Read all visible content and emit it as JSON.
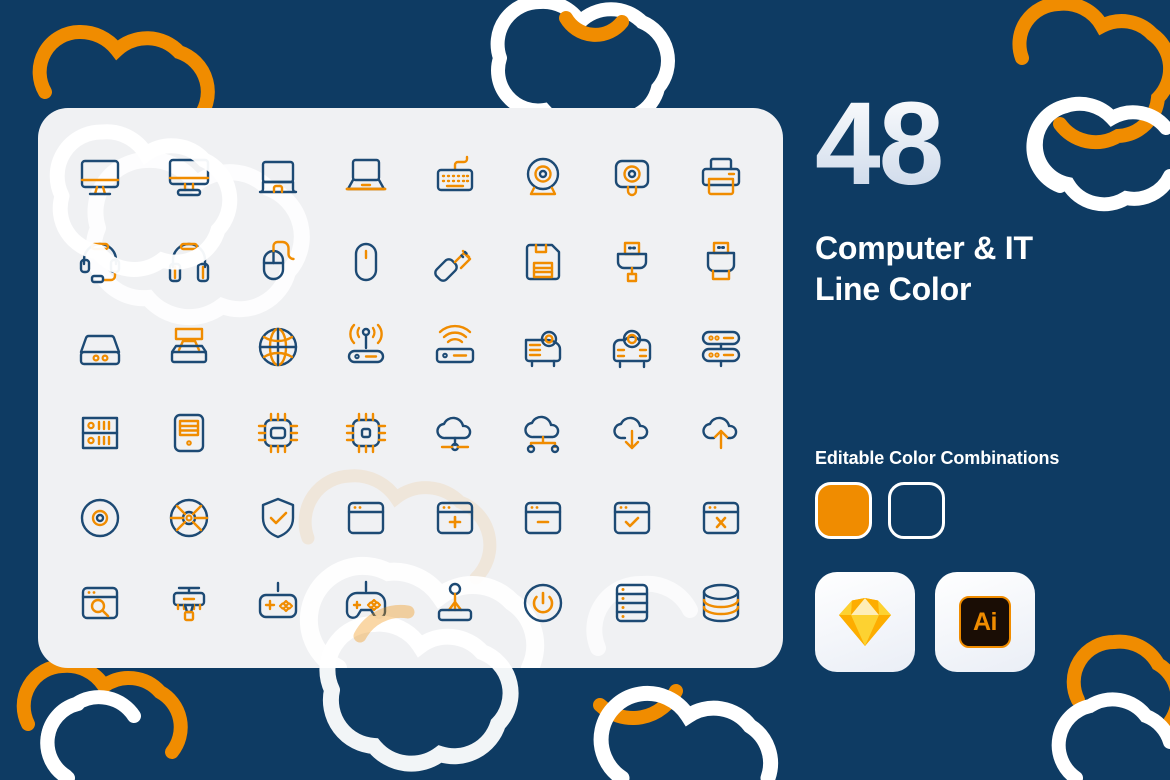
{
  "palette": {
    "background_navy": "#0E3B63",
    "card_gray": "#F0F1F3",
    "accent_orange": "#F08C00",
    "icon_navy": "#1D4A74",
    "white": "#FFFFFF"
  },
  "right_panel": {
    "count": "48",
    "title_line1": "Computer & IT",
    "title_line2": "Line Color",
    "combinations_label": "Editable Color Combinations",
    "swatches": [
      {
        "name": "orange-swatch",
        "style": "filled",
        "color": "#F08C00"
      },
      {
        "name": "outline-swatch",
        "style": "hollow",
        "color": "#FFFFFF"
      }
    ],
    "apps": [
      {
        "name": "sketch-badge",
        "label": ""
      },
      {
        "name": "illustrator-badge",
        "label": "Ai"
      }
    ]
  },
  "icon_grid": {
    "columns": 8,
    "rows": 6,
    "icons": [
      {
        "name": "desktop-monitor-icon"
      },
      {
        "name": "desktop-monitor-stand-icon"
      },
      {
        "name": "laptop-closed-icon"
      },
      {
        "name": "laptop-open-icon"
      },
      {
        "name": "keyboard-icon"
      },
      {
        "name": "webcam-round-icon"
      },
      {
        "name": "webcam-square-icon"
      },
      {
        "name": "printer-icon"
      },
      {
        "name": "headset-icon"
      },
      {
        "name": "headphones-icon"
      },
      {
        "name": "mouse-wired-icon"
      },
      {
        "name": "mouse-wireless-icon"
      },
      {
        "name": "usb-flash-drive-icon"
      },
      {
        "name": "floppy-disk-icon"
      },
      {
        "name": "usb-connector-icon"
      },
      {
        "name": "usb-plug-icon"
      },
      {
        "name": "external-hard-drive-icon"
      },
      {
        "name": "scanner-icon"
      },
      {
        "name": "globe-network-icon"
      },
      {
        "name": "wireless-router-icon"
      },
      {
        "name": "wifi-modem-icon"
      },
      {
        "name": "projector-icon"
      },
      {
        "name": "projector-front-icon"
      },
      {
        "name": "server-stack-icon"
      },
      {
        "name": "server-rack-icon"
      },
      {
        "name": "computer-tower-icon"
      },
      {
        "name": "cpu-chip-icon"
      },
      {
        "name": "processor-icon"
      },
      {
        "name": "cloud-network-icon"
      },
      {
        "name": "cloud-computing-icon"
      },
      {
        "name": "cloud-download-icon"
      },
      {
        "name": "cloud-upload-icon"
      },
      {
        "name": "compact-disc-icon"
      },
      {
        "name": "dvd-disc-icon"
      },
      {
        "name": "security-shield-icon"
      },
      {
        "name": "browser-window-icon"
      },
      {
        "name": "browser-add-icon"
      },
      {
        "name": "browser-remove-icon"
      },
      {
        "name": "browser-check-icon"
      },
      {
        "name": "browser-close-icon"
      },
      {
        "name": "browser-search-icon"
      },
      {
        "name": "printer-3d-icon"
      },
      {
        "name": "gamepad-icon"
      },
      {
        "name": "game-controller-icon"
      },
      {
        "name": "joystick-icon"
      },
      {
        "name": "power-button-icon"
      },
      {
        "name": "server-database-icon"
      },
      {
        "name": "database-icon"
      }
    ]
  }
}
